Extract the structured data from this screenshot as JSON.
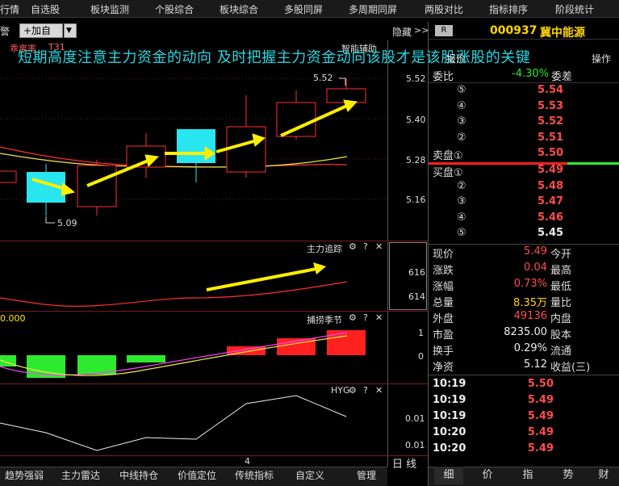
{
  "menu": [
    "行情",
    "自选股",
    "板块监测",
    "个股综合",
    "板块综合",
    "多股同屏",
    "多周期同屏",
    "两股对比",
    "指标排序",
    "阶段统计"
  ],
  "toolbar": {
    "left_text": "警",
    "add_button": "+加自选",
    "dropdown_arrow": "▼",
    "hide_label": "隐藏",
    "expand_label": ">>"
  },
  "stock": {
    "badge": "R",
    "code": "000937",
    "name": "冀中能源"
  },
  "banner": "短期高度注意主力资金的动向 及时把握主力资金动向该股才是该股涨股的关键",
  "main_chart": {
    "indicator_name": "乖离率",
    "indicator_value": "T31",
    "smart_label": "智能辅助",
    "high_label": "5.52",
    "low_label": "5.09",
    "y_ticks": [
      "5.52",
      "5.40",
      "5.28",
      "5.16"
    ]
  },
  "panel2": {
    "title": "主力追踪",
    "y_ticks": [
      "616",
      "614"
    ]
  },
  "panel3": {
    "title": "捕捞季节",
    "left_value": "0.000",
    "y_ticks": [
      "1",
      "0"
    ]
  },
  "panel4": {
    "title": "HYG",
    "y_ticks": [
      "0.01",
      "0.01"
    ]
  },
  "x_axis_label": "4",
  "period_label": "日 线",
  "icons": {
    "gear": "⚙",
    "help": "?",
    "close": "✕"
  },
  "bottom_tabs": [
    "趋势强弱",
    "主力雷达",
    "中线持仓",
    "价值定位",
    "传统指标",
    "自定义",
    "管理"
  ],
  "right_bottom_tabs": [
    "细",
    "价",
    "指",
    "势",
    "财"
  ],
  "orderbook": {
    "header": {
      "ratio_label": "委比",
      "ratio_val": "-4.30%",
      "diff_label": "委差",
      "top_left": "报价",
      "top_right": "操作"
    },
    "asks": [
      {
        "label": "⑤",
        "price": "5.54"
      },
      {
        "label": "④",
        "price": "5.53"
      },
      {
        "label": "③",
        "price": "5.52"
      },
      {
        "label": "②",
        "price": "5.51"
      },
      {
        "label": "卖盘①",
        "price": "5.50"
      }
    ],
    "bids": [
      {
        "label": "买盘①",
        "price": "5.49"
      },
      {
        "label": "②",
        "price": "5.48"
      },
      {
        "label": "③",
        "price": "5.47"
      },
      {
        "label": "④",
        "price": "5.46"
      },
      {
        "label": "⑤",
        "price": "5.45"
      }
    ]
  },
  "quote": [
    {
      "l": "现价",
      "v": "5.49",
      "r": "今开",
      "c": "red"
    },
    {
      "l": "涨跌",
      "v": "0.04",
      "r": "最高",
      "c": "red"
    },
    {
      "l": "涨幅",
      "v": "0.73%",
      "r": "最低",
      "c": "red"
    },
    {
      "l": "总量",
      "v": "8.35万",
      "r": "量比",
      "c": "yellow"
    },
    {
      "l": "外盘",
      "v": "49136",
      "r": "内盘",
      "c": "red"
    },
    {
      "l": "市盈",
      "v": "8235.00",
      "r": "股本",
      "c": "white"
    },
    {
      "l": "换手",
      "v": "0.29%",
      "r": "流通",
      "c": "white"
    },
    {
      "l": "净资",
      "v": "5.12",
      "r": "收益(三)",
      "c": "white"
    }
  ],
  "ticks": [
    {
      "t": "10:19",
      "p": "5.50"
    },
    {
      "t": "10:19",
      "p": "5.49"
    },
    {
      "t": "10:19",
      "p": "5.49"
    },
    {
      "t": "10:20",
      "p": "5.49"
    },
    {
      "t": "10:20",
      "p": "5.49"
    }
  ],
  "colors": {
    "up": "#ff4d4d",
    "down": "#2eea2e",
    "cyan": "#27e6f0",
    "arrow": "#ffee00"
  }
}
